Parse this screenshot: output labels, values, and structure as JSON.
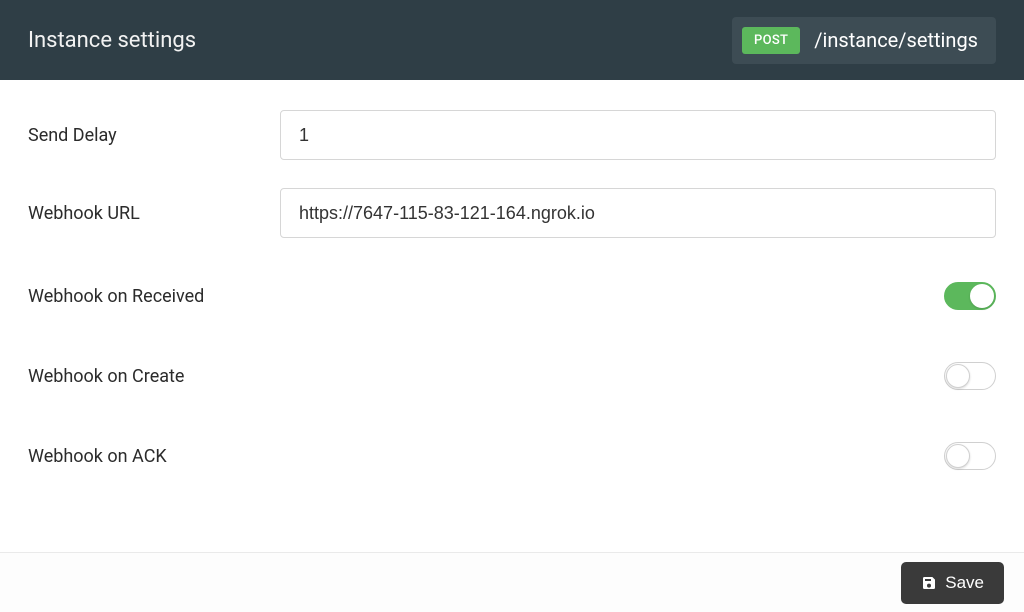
{
  "header": {
    "title": "Instance settings",
    "method": "POST",
    "endpoint": "/instance/settings"
  },
  "fields": {
    "send_delay": {
      "label": "Send Delay",
      "value": "1"
    },
    "webhook_url": {
      "label": "Webhook URL",
      "value": "https://7647-115-83-121-164.ngrok.io"
    },
    "webhook_on_received": {
      "label": "Webhook on Received",
      "on": true
    },
    "webhook_on_create": {
      "label": "Webhook on Create",
      "on": false
    },
    "webhook_on_ack": {
      "label": "Webhook on ACK",
      "on": false
    }
  },
  "footer": {
    "save_label": "Save"
  }
}
